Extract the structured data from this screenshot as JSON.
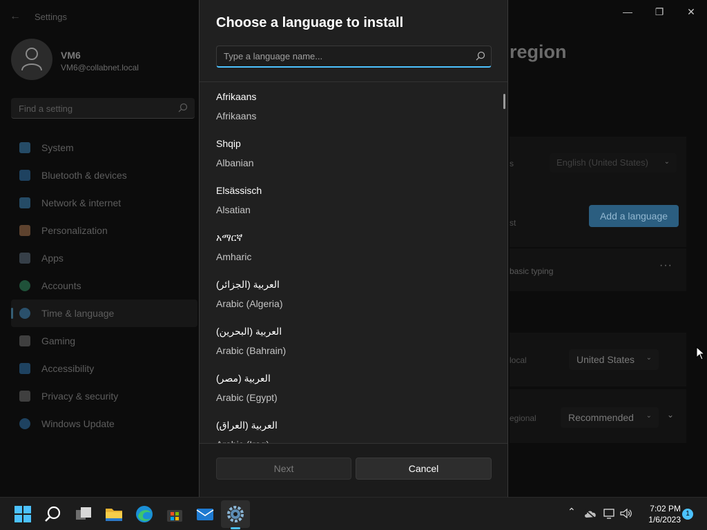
{
  "settings": {
    "title": "Settings",
    "user": {
      "name": "VM6",
      "email": "VM6@collabnet.local"
    },
    "search_placeholder": "Find a setting",
    "nav": [
      {
        "label": "System",
        "icon": "monitor-icon",
        "color": "#3a7fb0"
      },
      {
        "label": "Bluetooth & devices",
        "icon": "bluetooth-icon",
        "color": "#2d6fa6"
      },
      {
        "label": "Network & internet",
        "icon": "wifi-icon",
        "color": "#3a7fb0"
      },
      {
        "label": "Personalization",
        "icon": "brush-icon",
        "color": "#a0704a"
      },
      {
        "label": "Apps",
        "icon": "apps-icon",
        "color": "#5a6a7a"
      },
      {
        "label": "Accounts",
        "icon": "person-icon",
        "color": "#2f8a5f"
      },
      {
        "label": "Time & language",
        "icon": "globe-clock-icon",
        "color": "#3a7fb0",
        "active": true
      },
      {
        "label": "Gaming",
        "icon": "gamepad-icon",
        "color": "#6a6a6a"
      },
      {
        "label": "Accessibility",
        "icon": "accessibility-icon",
        "color": "#2d6fa6"
      },
      {
        "label": "Privacy & security",
        "icon": "shield-icon",
        "color": "#6a6a6a"
      },
      {
        "label": "Windows Update",
        "icon": "update-icon",
        "color": "#2d6fa6"
      }
    ],
    "page_title_fragment": "region",
    "background": {
      "display_language_label_fragment": "s",
      "display_language_value": "English (United States)",
      "preferred_fragment": "st",
      "add_language_button": "Add a language",
      "language_row_fragment": "basic typing",
      "more_label": "···",
      "country_label_fragment": "local",
      "country_value": "United States",
      "format_label_fragment": "egional",
      "format_value": "Recommended"
    }
  },
  "dialog": {
    "title": "Choose a language to install",
    "search_placeholder": "Type a language name...",
    "languages": [
      {
        "native": "Afrikaans",
        "english": "Afrikaans"
      },
      {
        "native": "Shqip",
        "english": "Albanian"
      },
      {
        "native": "Elsässisch",
        "english": "Alsatian"
      },
      {
        "native": "አማርኛ",
        "english": "Amharic"
      },
      {
        "native": "العربية (الجزائر)",
        "english": "Arabic (Algeria)"
      },
      {
        "native": "العربية (البحرين)",
        "english": "Arabic (Bahrain)"
      },
      {
        "native": "العربية (مصر)",
        "english": "Arabic (Egypt)"
      },
      {
        "native": "العربية (العراق)",
        "english": "Arabic (Iraq)"
      }
    ],
    "next_button": "Next",
    "cancel_button": "Cancel"
  },
  "taskbar": {
    "time": "7:02 PM",
    "date": "1/6/2023",
    "notification_count": "1",
    "accent": "#4cc2ff"
  }
}
